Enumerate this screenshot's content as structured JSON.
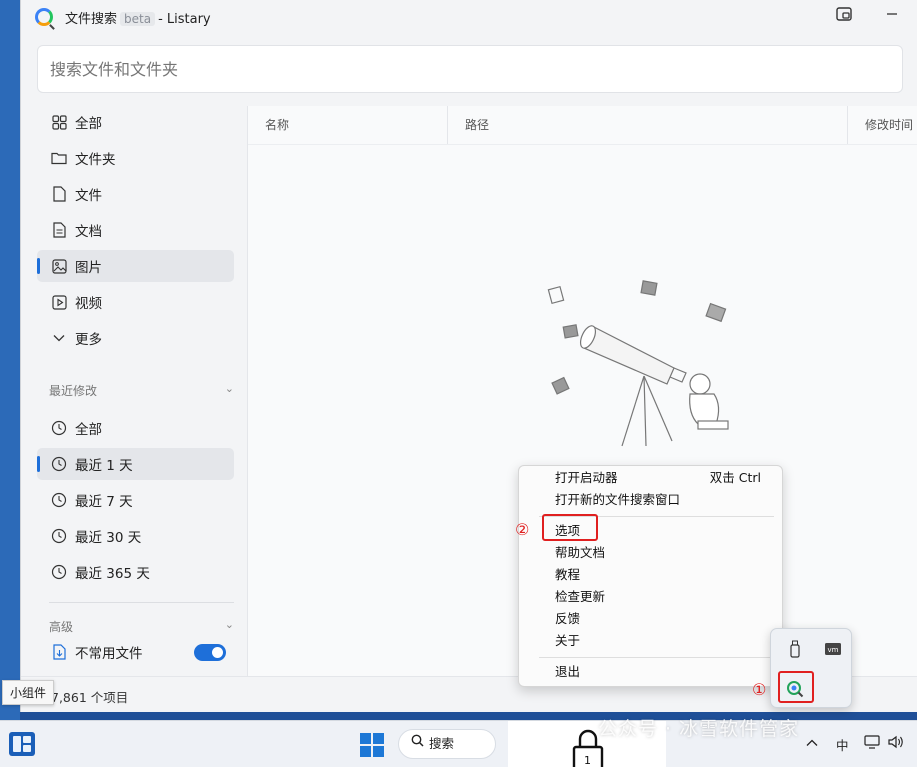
{
  "window": {
    "title_app": "文件搜索",
    "title_beta": "beta",
    "title_suffix": "- Listary"
  },
  "search": {
    "placeholder": "搜索文件和文件夹"
  },
  "sidebar": {
    "categories": [
      {
        "label": "全部",
        "icon": "grid-icon"
      },
      {
        "label": "文件夹",
        "icon": "folder-icon"
      },
      {
        "label": "文件",
        "icon": "file-icon"
      },
      {
        "label": "文档",
        "icon": "document-icon"
      },
      {
        "label": "图片",
        "icon": "image-icon",
        "active": true
      },
      {
        "label": "视频",
        "icon": "video-icon"
      },
      {
        "label": "更多",
        "icon": "chevron-down-icon"
      }
    ],
    "recent_heading": "最近修改",
    "recent": [
      {
        "label": "全部",
        "icon": "clock-icon"
      },
      {
        "label": "最近 1 天",
        "icon": "clock-icon",
        "active": true
      },
      {
        "label": "最近 7 天",
        "icon": "clock-icon"
      },
      {
        "label": "最近 30 天",
        "icon": "clock-icon"
      },
      {
        "label": "最近 365 天",
        "icon": "clock-icon"
      }
    ],
    "advanced_heading": "高级",
    "rare_files_label": "不常用文件",
    "rare_files_toggle": "on"
  },
  "table": {
    "columns": [
      "名称",
      "路径",
      "修改时间"
    ]
  },
  "status": {
    "count": "7,861 个项目"
  },
  "tooltip": {
    "text": "小组件"
  },
  "context_menu": {
    "items_group1": [
      {
        "label": "打开启动器",
        "shortcut": "双击 Ctrl"
      },
      {
        "label": "打开新的文件搜索窗口",
        "shortcut": ""
      }
    ],
    "items_group2": [
      "选项",
      "帮助文档",
      "教程",
      "检查更新",
      "反馈",
      "关于"
    ],
    "exit": "退出"
  },
  "annotations": {
    "step1": "①",
    "step2": "②"
  },
  "taskbar": {
    "search_label": "搜索",
    "lock_number": "1",
    "ime": "中",
    "chevron_icon": "chevron-up-icon"
  },
  "watermark": "公众号 · 冰雪软件管家",
  "colors": {
    "accent": "#1e6fd9",
    "annotation_red": "#e02020"
  }
}
